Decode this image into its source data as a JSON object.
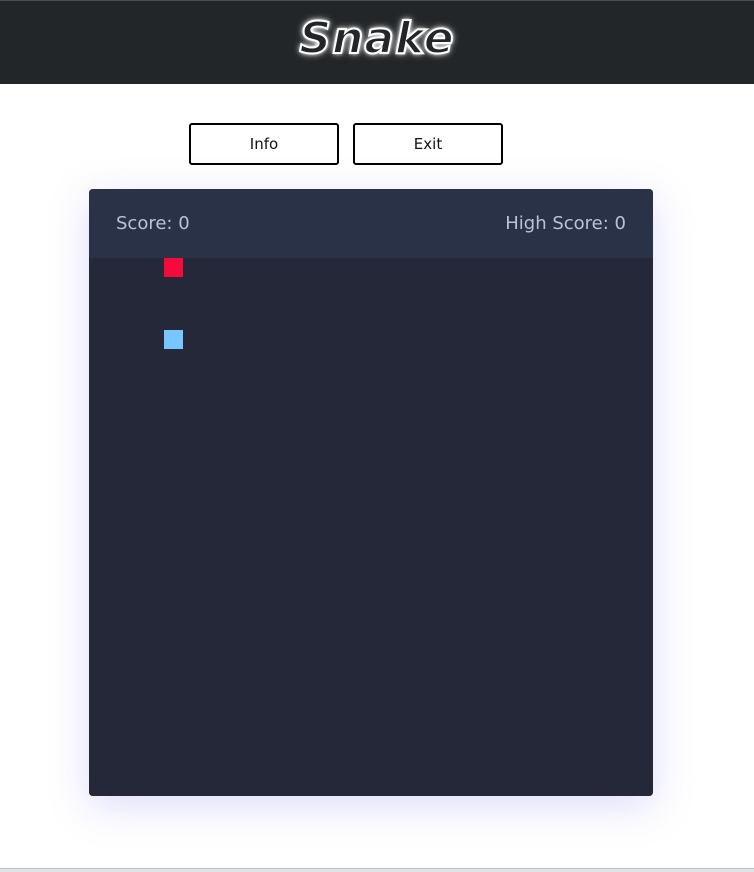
{
  "header": {
    "title": "Snake"
  },
  "controls": {
    "info_label": "Info",
    "exit_label": "Exit"
  },
  "scoreboard": {
    "score_text": "Score: 0",
    "high_score_text": "High Score: 0"
  },
  "board": {
    "food": {
      "color": "#f50a3a"
    },
    "snake": {
      "color": "#78c6ff",
      "length": 1
    }
  },
  "colors": {
    "header_bg": "#222629",
    "board_bg": "#252838",
    "score_bar_bg": "#2a3247",
    "score_text": "#b9c3d8"
  }
}
